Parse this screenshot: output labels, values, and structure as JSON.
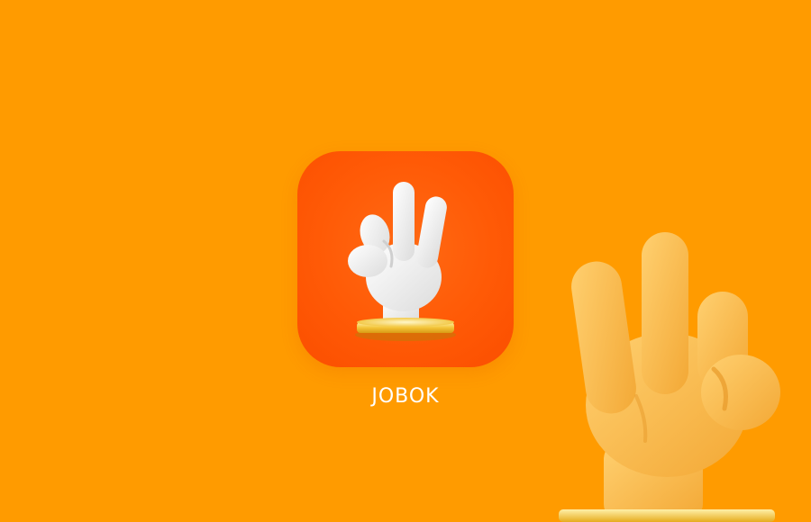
{
  "background_color": "#ff9b00",
  "app": {
    "name": "JOBOK",
    "icon": "ok-hand-gesture-icon",
    "icon_bg_color": "#ff5a06",
    "label_color": "#ffffff"
  },
  "decoration": {
    "icon": "ok-hand-gesture-icon",
    "color": "#f8b84e"
  }
}
